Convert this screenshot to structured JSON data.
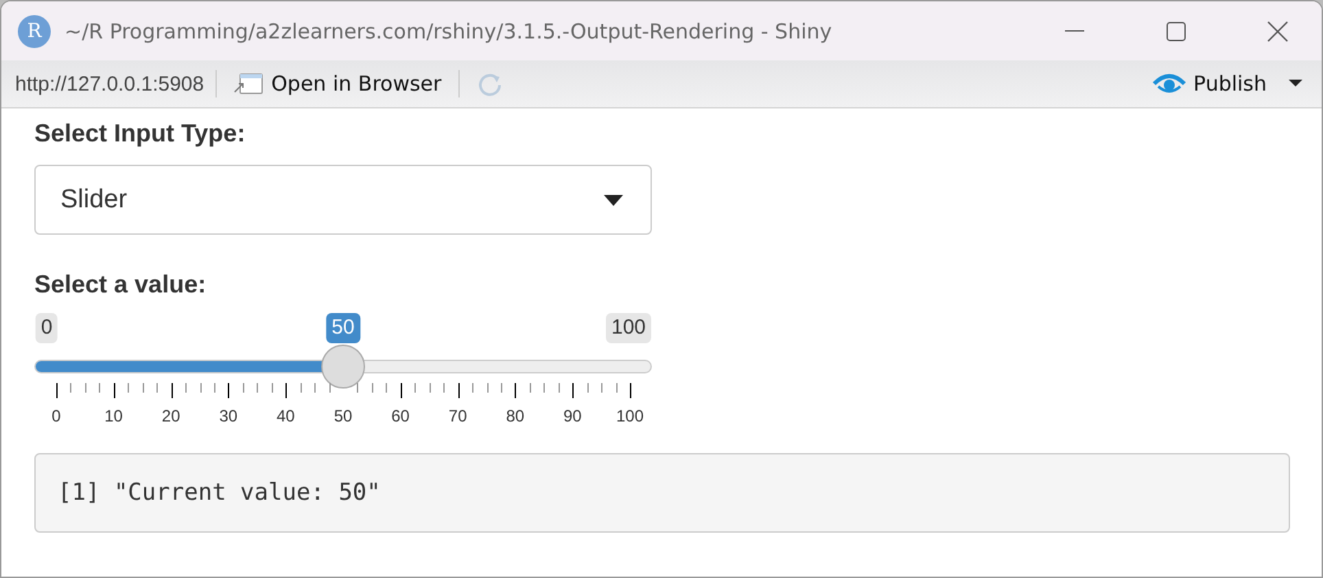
{
  "window": {
    "title": "~/R Programming/a2zlearners.com/rshiny/3.1.5.-Output-Rendering - Shiny",
    "app_icon_letter": "R"
  },
  "toolbar": {
    "url": "http://127.0.0.1:5908",
    "open_in_browser": "Open in Browser",
    "publish": "Publish"
  },
  "select_input": {
    "label": "Select Input Type:",
    "value": "Slider"
  },
  "slider": {
    "label": "Select a value:",
    "min_label": "0",
    "max_label": "100",
    "value_label": "50",
    "level": 0.5,
    "ticks": [
      "0",
      "10",
      "20",
      "30",
      "40",
      "50",
      "60",
      "70",
      "80",
      "90",
      "100"
    ]
  },
  "output": {
    "text": "[1] \"Current value: 50\""
  }
}
